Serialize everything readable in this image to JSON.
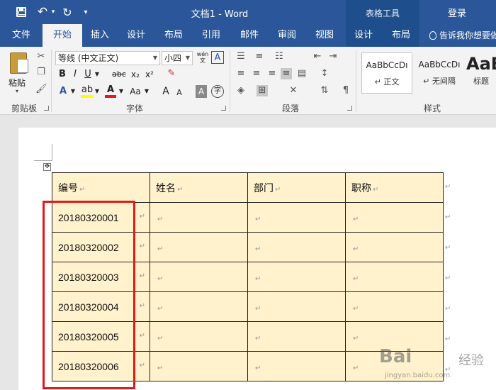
{
  "titlebar": {
    "title": "文档1  -  Word",
    "context_group": "表格工具",
    "login": "登录"
  },
  "tabs": [
    {
      "label": "文件"
    },
    {
      "label": "开始"
    },
    {
      "label": "插入"
    },
    {
      "label": "设计"
    },
    {
      "label": "布局"
    },
    {
      "label": "引用"
    },
    {
      "label": "邮件"
    },
    {
      "label": "审阅"
    },
    {
      "label": "视图"
    },
    {
      "label": "设计"
    },
    {
      "label": "布局"
    }
  ],
  "tellme": "告诉我你想要做",
  "ribbon": {
    "paste_label": "粘贴",
    "font_name": "等线 (中文正文)",
    "font_size": "小四",
    "wen_label": "wén",
    "fmt": {
      "bold": "B",
      "italic": "I",
      "underline": "U",
      "strike": "abc",
      "sub": "x₂",
      "sup": "x²",
      "case": "Aa",
      "grow": "A",
      "shrink": "A",
      "char_border": "A",
      "phonetic": "字"
    },
    "groups": {
      "clipboard": "剪贴板",
      "font": "字体",
      "paragraph": "段落",
      "styles": "样式"
    },
    "styles": [
      {
        "sample": "AaBbCcDı",
        "name": "↵ 正文"
      },
      {
        "sample": "AaBbCcDı",
        "name": "↵ 无间隔"
      },
      {
        "sample": "AaB",
        "name": "标题"
      }
    ]
  },
  "table": {
    "headers": [
      "编号",
      "姓名",
      "部门",
      "职称"
    ],
    "rows": [
      "20180320001",
      "20180320002",
      "20180320003",
      "20180320004",
      "20180320005",
      "20180320006"
    ],
    "para_mark": "↵"
  },
  "watermark": {
    "brand": "Bai",
    "sub": "经验",
    "url": "jingyan.baidu.com"
  },
  "colors": {
    "titlebar": "#2b579a",
    "cell_fill": "#fff2cc",
    "highlight": "#e11a1a"
  }
}
